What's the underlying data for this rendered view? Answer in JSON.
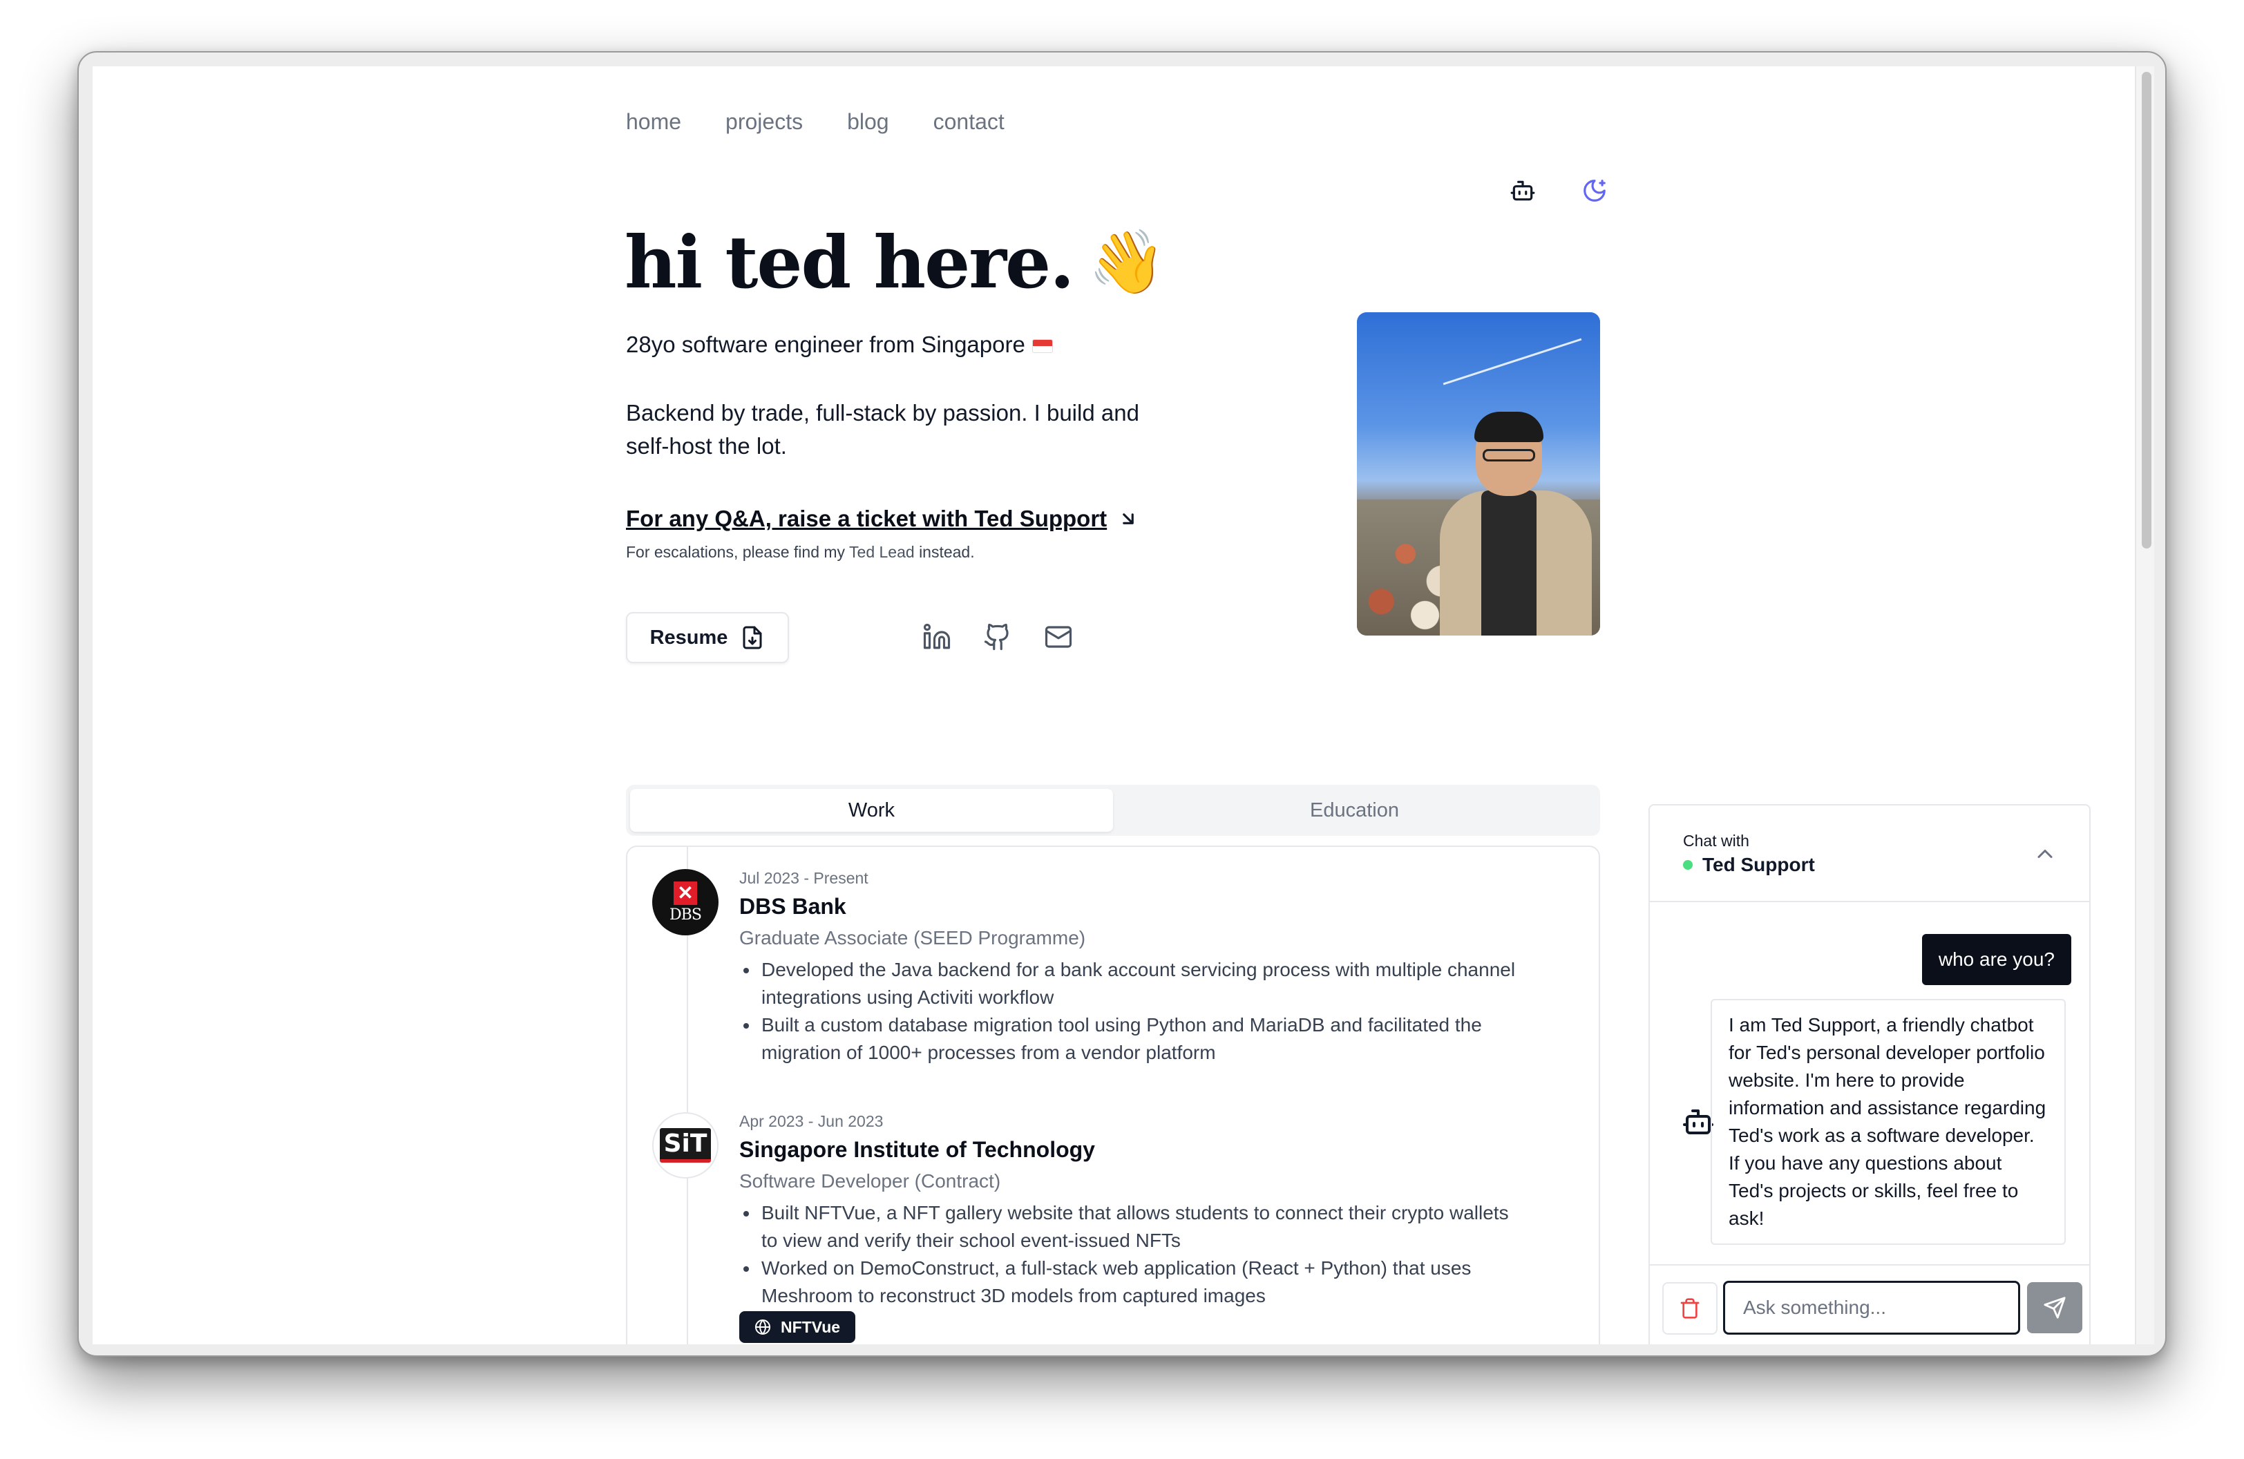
{
  "nav": {
    "links": [
      "home",
      "projects",
      "blog",
      "contact"
    ],
    "chatbot_icon": "bot-icon",
    "theme_icon": "moon-icon"
  },
  "hero": {
    "title": "hi ted here.",
    "wave_emoji": "👋",
    "subtitle": "28yo software engineer from Singapore",
    "flag_icon": "singapore-flag-icon",
    "description": "Backend by trade, full-stack by passion. I build and self-host the lot.",
    "qa_text": "For any Q&A, raise a ticket with Ted Support",
    "escalation_prefix": "For escalations, please find my",
    "escalation_link": "Ted Lead",
    "escalation_suffix": "instead.",
    "resume_label": "Resume",
    "social_icons": [
      "linkedin-icon",
      "github-icon",
      "mail-icon"
    ]
  },
  "tabs": [
    {
      "label": "Work",
      "active": true
    },
    {
      "label": "Education",
      "active": false
    }
  ],
  "experience": [
    {
      "date": "Jul 2023 - Present",
      "company": "DBS Bank",
      "logo_text": "DBS",
      "role": "Graduate Associate (SEED Programme)",
      "bullets": [
        "Developed the Java backend for a bank account servicing process with multiple channel integrations using Activiti workflow",
        "Built a custom database migration tool using Python and MariaDB and facilitated the migration of 1000+ processes from a vendor platform"
      ]
    },
    {
      "date": "Apr 2023 - Jun 2023",
      "company": "Singapore Institute of Technology",
      "logo_text": "SiT",
      "role": "Software Developer (Contract)",
      "bullets": [
        "Built NFTVue, a NFT gallery website that allows students to connect their crypto wallets to view and verify their school event-issued NFTs",
        "Worked on DemoConstruct, a full-stack web application (React + Python) that uses Meshroom to reconstruct 3D models from captured images"
      ],
      "link_chip": "NFTVue"
    }
  ],
  "chat": {
    "header_label": "Chat with",
    "bot_name": "Ted Support",
    "status_color": "#4ade80",
    "user_message": "who are you?",
    "bot_message": "I am Ted Support, a friendly chatbot for Ted's personal developer portfolio website. I'm here to provide information and assistance regarding Ted's work as a software developer. If you have any questions about Ted's projects or skills, feel free to ask!",
    "input_placeholder": "Ask something..."
  },
  "colors": {
    "accent_dark": "#0b0f19",
    "muted_text": "#6b7280",
    "border": "#e5e7eb",
    "moon_icon": "#6366f1",
    "trash_icon": "#ef4444",
    "dbs_red": "#e11d2a"
  }
}
